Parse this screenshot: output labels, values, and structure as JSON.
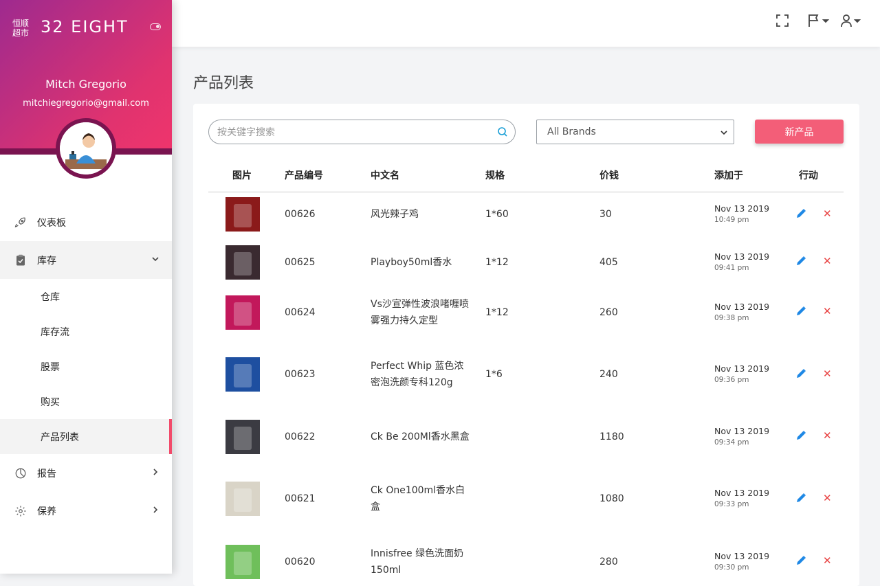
{
  "brand": {
    "logo_line1": "恒顺",
    "logo_line2": "超市",
    "name": "32 EIGHT"
  },
  "user": {
    "name": "Mitch Gregorio",
    "email": "mitchiegregorio@gmail.com"
  },
  "nav": {
    "dashboard": "仪表板",
    "inventory": "库存",
    "sub": {
      "warehouse": "仓库",
      "stock_flow": "库存流",
      "stocks": "股票",
      "purchase": "购买",
      "product_list": "产品列表"
    },
    "reports": "报告",
    "maintenance": "保养"
  },
  "page_title": "产品列表",
  "toolbar": {
    "search_placeholder": "按关键字搜索",
    "brand_select": "All Brands",
    "new_button": "新产品"
  },
  "table": {
    "headers": {
      "image": "图片",
      "code": "产品编号",
      "name": "中文名",
      "spec": "规格",
      "price": "价钱",
      "added": "添加于",
      "action": "行动"
    },
    "rows": [
      {
        "code": "00626",
        "name": "风光辣子鸡",
        "spec": "1*60",
        "price": "30",
        "date": "Nov 13 2019",
        "time": "10:49 pm",
        "thumb_color": "#8b1a1a"
      },
      {
        "code": "00625",
        "name": "Playboy50ml香水",
        "spec": "1*12",
        "price": "405",
        "date": "Nov 13 2019",
        "time": "09:41 pm",
        "thumb_color": "#3a2a30"
      },
      {
        "code": "00624",
        "name": "Vs沙宣弹性波浪啫喱喷雾强力持久定型",
        "spec": "1*12",
        "price": "260",
        "date": "Nov 13 2019",
        "time": "09:38 pm",
        "thumb_color": "#c2185b"
      },
      {
        "code": "00623",
        "name": "Perfect Whip 蓝色浓密泡洗颜专科120g",
        "spec": "1*6",
        "price": "240",
        "date": "Nov 13 2019",
        "time": "09:36 pm",
        "thumb_color": "#1e4fa0"
      },
      {
        "code": "00622",
        "name": "Ck Be 200Ml香水黑盒",
        "spec": "",
        "price": "1180",
        "date": "Nov 13 2019",
        "time": "09:34 pm",
        "thumb_color": "#3b3b42"
      },
      {
        "code": "00621",
        "name": "Ck One100ml香水白盒",
        "spec": "",
        "price": "1080",
        "date": "Nov 13 2019",
        "time": "09:33 pm",
        "thumb_color": "#d9d4c7"
      },
      {
        "code": "00620",
        "name": "Innisfree 绿色洗面奶150ml",
        "spec": "",
        "price": "280",
        "date": "Nov 13 2019",
        "time": "09:30 pm",
        "thumb_color": "#6fbf5b"
      }
    ]
  }
}
